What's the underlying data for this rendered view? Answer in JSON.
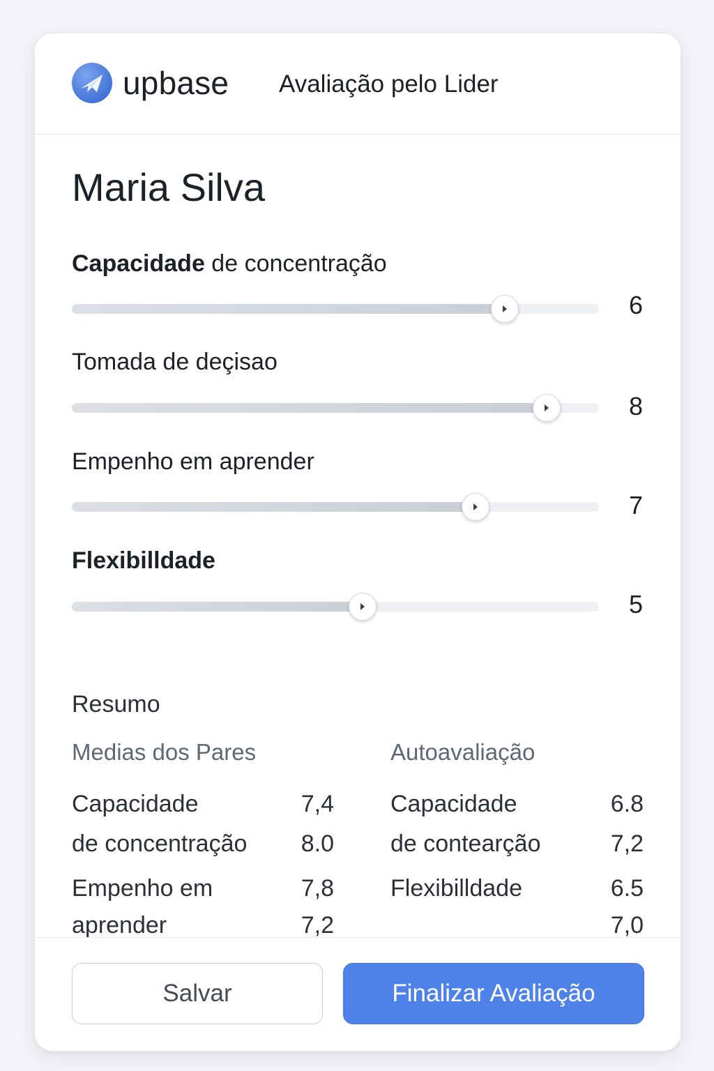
{
  "header": {
    "brand": "upbase",
    "title": "Avaliação pelo Lider"
  },
  "person": {
    "name": "Maria Silva"
  },
  "criteria": [
    {
      "label_strong": "Capacidade",
      "label_rest": " de concentração",
      "score": "6",
      "level": 0.82
    },
    {
      "label": "Tomada de deçisao",
      "score": "8",
      "level": 0.9
    },
    {
      "label": "Empenho em aprender",
      "score": "7",
      "level": 0.765
    },
    {
      "label": "Flexibilldade",
      "score": "5",
      "level": 0.55
    }
  ],
  "summary": {
    "title": "Resumo",
    "peers": {
      "title": "Medias dos Pares",
      "rows": [
        {
          "label": "Capacidade",
          "value": "7,4"
        },
        {
          "label": "de concentração",
          "value": "8.0"
        },
        {
          "label": "Empenho em",
          "value": "7,8"
        },
        {
          "label": "aprender",
          "value": "7,2"
        }
      ]
    },
    "self": {
      "title": "Autoavaliação",
      "rows": [
        {
          "label": "Capacidade",
          "value": "6.8"
        },
        {
          "label": "de contearção",
          "value": "7,2"
        },
        {
          "label": "Flexibilldade",
          "value": "6.5"
        },
        {
          "label": "",
          "value": "7,0"
        }
      ]
    }
  },
  "actions": {
    "save_label": "Salvar",
    "finish_label": "Finalizar Avaliação"
  },
  "colors": {
    "accent": "#4e82e9",
    "logo": "#5a86e0"
  },
  "icons": {
    "logo": "paper-plane-logo-icon",
    "thumb": "play-arrow-icon"
  }
}
